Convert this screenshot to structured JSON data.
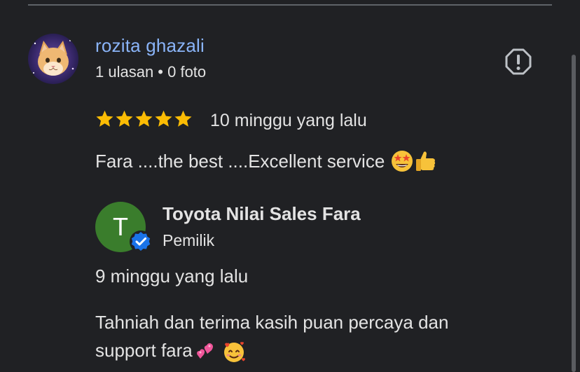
{
  "review": {
    "reviewer_name": "rozita ghazali",
    "reviewer_meta": "1 ulasan • 0 foto",
    "rating": 5,
    "rating_max": 5,
    "time": "10 minggu yang lalu",
    "text": "Fara ....the best ....Excellent service",
    "text_emojis": [
      "star-struck-emoji",
      "thumbs-up-emoji"
    ]
  },
  "owner_reply": {
    "initial": "T",
    "name": "Toyota Nilai Sales Fara",
    "role": "Pemilik",
    "time": "9 minggu yang lalu",
    "text_line1": "Tahniah dan terima kasih puan percaya dan",
    "text_line2": "support fara",
    "text_emojis": [
      "two-hearts-emoji",
      "smiling-face-with-hearts-emoji"
    ]
  },
  "icons": {
    "report": "report-icon",
    "verified": "verified-badge-icon",
    "star": "star-icon"
  },
  "colors": {
    "background": "#202124",
    "reviewer_name": "#8ab4f8",
    "star": "#fbbc04",
    "owner_avatar": "#3a7d2c",
    "verified_badge": "#1a73e8"
  }
}
